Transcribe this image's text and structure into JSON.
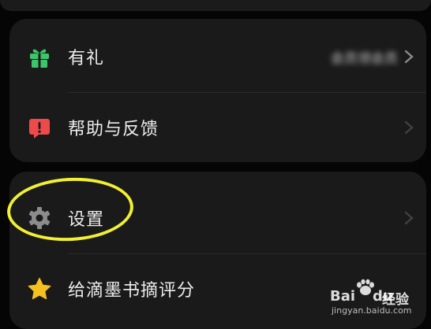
{
  "menu": {
    "gift": {
      "label": "有礼",
      "hint": "会员领会员",
      "icon": "gift-icon",
      "color": "#3ec46d"
    },
    "help": {
      "label": "帮助与反馈",
      "icon": "feedback-icon",
      "color": "#ef4a4a"
    },
    "settings": {
      "label": "设置",
      "icon": "gear-icon",
      "color": "#8c8c8c"
    },
    "rate": {
      "label": "给滴墨书摘评分",
      "icon": "star-icon",
      "color": "#f6c11e"
    }
  },
  "annotation": {
    "highlight_color": "#f1f033"
  },
  "watermark": {
    "brand": "Bai",
    "brand2": "du",
    "text": "经验",
    "url": "jingyan.baidu.com"
  }
}
